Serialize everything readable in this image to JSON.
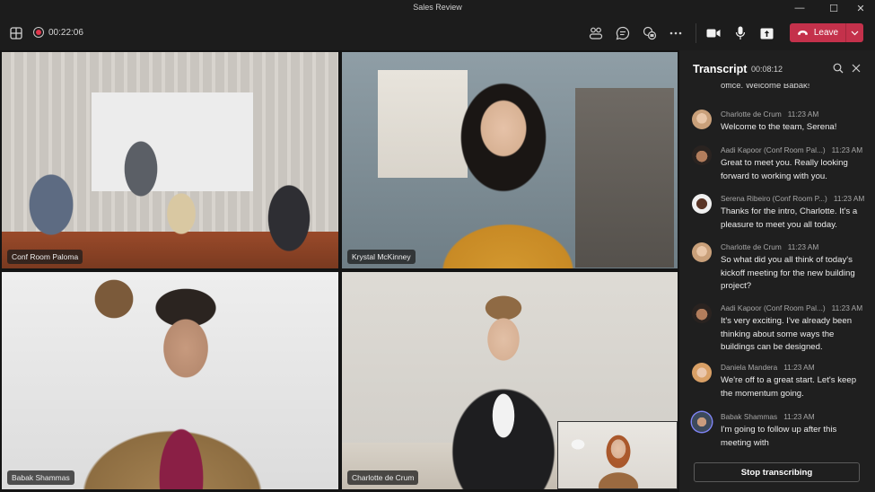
{
  "window": {
    "title": "Sales Review",
    "controls": [
      {
        "name": "minimize",
        "glyph": "—"
      },
      {
        "name": "maximize",
        "glyph": "☐"
      },
      {
        "name": "close",
        "glyph": "✕"
      }
    ]
  },
  "toolbar": {
    "layout_icon": "grid-layout-icon",
    "recording_icon": "recording-icon",
    "elapsed_time": "00:22:06",
    "actions": [
      {
        "name": "people",
        "icon": "people-icon"
      },
      {
        "name": "chat",
        "icon": "chat-icon"
      },
      {
        "name": "reactions",
        "icon": "reactions-icon"
      },
      {
        "name": "more",
        "icon": "more-icon"
      },
      {
        "name": "camera",
        "icon": "camera-icon"
      },
      {
        "name": "mic",
        "icon": "mic-icon"
      },
      {
        "name": "share",
        "icon": "share-icon"
      }
    ],
    "leave_label": "Leave",
    "leave_color": "#c4314b"
  },
  "participants": [
    {
      "name": "Conf Room Paloma"
    },
    {
      "name": "Krystal McKinney"
    },
    {
      "name": "Babak Shammas"
    },
    {
      "name": "Charlotte de Crum"
    }
  ],
  "self_view": {
    "label": "self-view"
  },
  "transcript": {
    "title": "Transcript",
    "duration": "00:08:12",
    "cutoff_text": "office. Welcome Babak!",
    "entries": [
      {
        "speaker": "Charlotte de Crum",
        "time": "11:23 AM",
        "text": "Welcome to the team, Serena!",
        "avatar_color": "#c9a07a"
      },
      {
        "speaker": "Aadi Kapoor (Conf Room Pal...)",
        "time": "11:23 AM",
        "text": "Great to meet you. Really looking forward to working with you.",
        "avatar_color": "#6a4b3a"
      },
      {
        "speaker": "Serena Ribeiro (Conf Room P...)",
        "time": "11:23 AM",
        "text": "Thanks for the intro, Charlotte. It's a pleasure to meet you all today.",
        "avatar_color": "#5a3526"
      },
      {
        "speaker": "Charlotte de Crum",
        "time": "11:23 AM",
        "text": "So what did you all think of today's kickoff meeting for the new building project?",
        "avatar_color": "#c9a07a"
      },
      {
        "speaker": "Aadi Kapoor (Conf Room Pal...)",
        "time": "11:23 AM",
        "text": "It's very exciting. I've already been thinking about some ways the buildings can be designed.",
        "avatar_color": "#6a4b3a"
      },
      {
        "speaker": "Daniela Mandera",
        "time": "11:23 AM",
        "text": "We're off to a great start. Let's keep the momentum going.",
        "avatar_color": "#d9a066"
      },
      {
        "speaker": "Babak Shammas",
        "time": "11:23 AM",
        "text": "I'm going to follow up after this meeting with",
        "avatar_color": "#3d4a5c",
        "active": true
      }
    ],
    "stop_label": "Stop transcribing"
  }
}
